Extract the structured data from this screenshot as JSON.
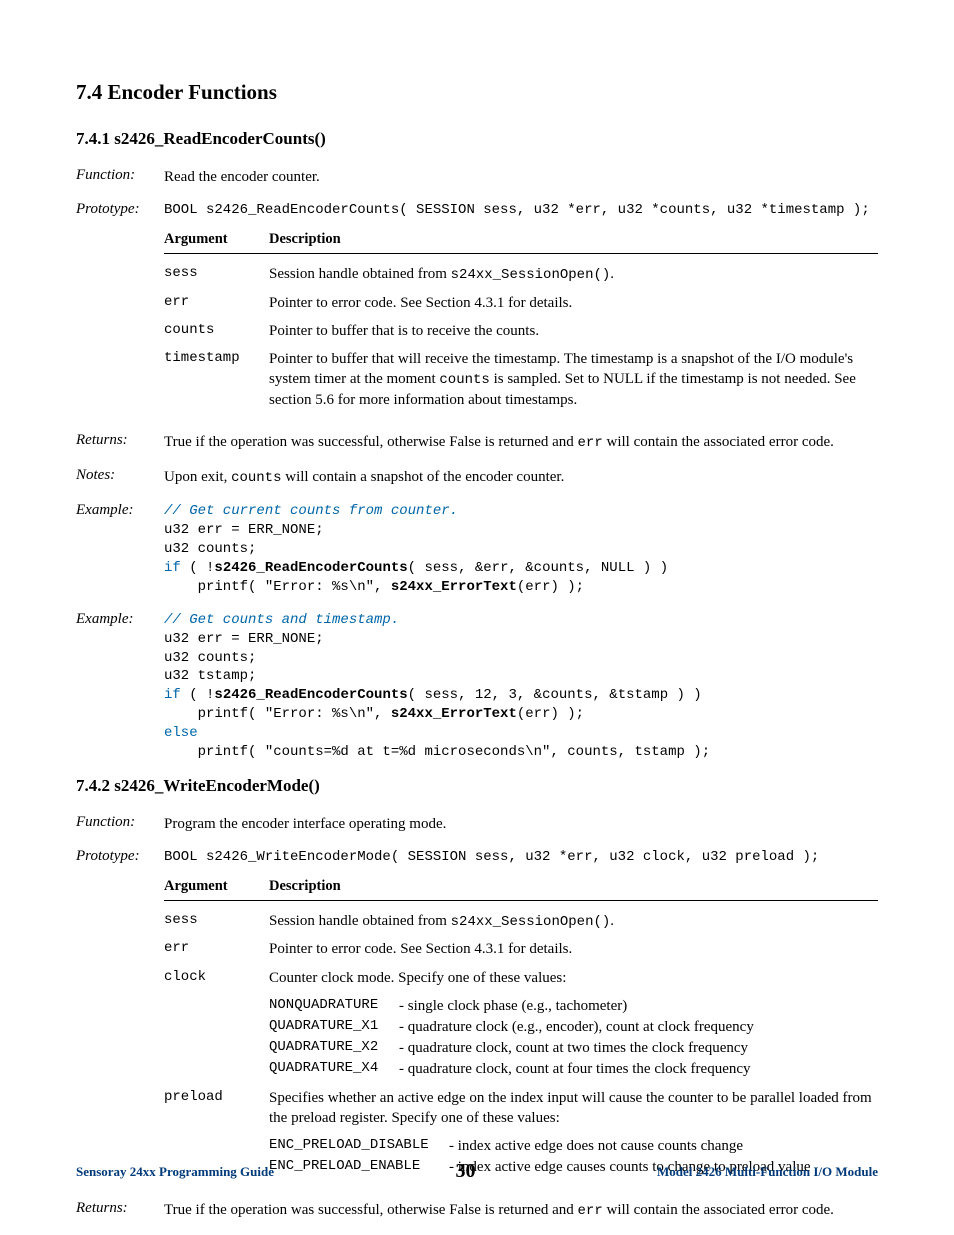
{
  "heading7_4": "7.4  Encoder Functions",
  "sec1": {
    "heading": "7.4.1  s2426_ReadEncoderCounts()",
    "function_label": "Function:",
    "function_text": "Read the encoder counter.",
    "prototype_label": "Prototype:",
    "prototype_code": "BOOL s2426_ReadEncoderCounts( SESSION sess, u32 *err, u32 *counts, u32 *timestamp );",
    "arg_head1": "Argument",
    "arg_head2": "Description",
    "args": {
      "sess_name": "sess",
      "sess_desc_a": "Session handle obtained from ",
      "sess_desc_b": "s24xx_SessionOpen()",
      "sess_desc_c": ".",
      "err_name": "err",
      "err_desc": "Pointer to error code. See Section 4.3.1 for details.",
      "counts_name": "counts",
      "counts_desc": "Pointer to buffer that is to receive the counts.",
      "ts_name": "timestamp",
      "ts_desc_a": "Pointer to buffer that will receive the timestamp. The timestamp is a snapshot of the I/O module's system timer at the moment ",
      "ts_desc_b": "counts",
      "ts_desc_c": " is sampled. Set to NULL if the timestamp is not needed. See section 5.6 for more information about timestamps."
    },
    "returns_label": "Returns:",
    "returns_a": "True if the operation was successful, otherwise False is returned and ",
    "returns_b": "err",
    "returns_c": " will contain the associated error code.",
    "notes_label": "Notes:",
    "notes_a": "Upon exit, ",
    "notes_b": "counts",
    "notes_c": " will contain a snapshot of the encoder counter.",
    "example_label": "Example:",
    "ex1": {
      "l1": "// Get current counts from counter.",
      "l2": "u32 err = ERR_NONE;",
      "l3": "u32 counts;",
      "l4a": "if",
      "l4b": " ( !",
      "l4c": "s2426_ReadEncoderCounts",
      "l4d": "( sess, &err, &counts, NULL ) )",
      "l5a": "    printf( \"Error: %s\\n\", ",
      "l5b": "s24xx_ErrorText",
      "l5c": "(err) );"
    },
    "ex2": {
      "l1": "// Get counts and timestamp.",
      "l2": "u32 err = ERR_NONE;",
      "l3": "u32 counts;",
      "l4": "u32 tstamp;",
      "l5a": "if",
      "l5b": " ( !",
      "l5c": "s2426_ReadEncoderCounts",
      "l5d": "( sess, 12, 3, &counts, &tstamp ) )",
      "l6a": "    printf( \"Error: %s\\n\", ",
      "l6b": "s24xx_ErrorText",
      "l6c": "(err) );",
      "l7": "else",
      "l8": "    printf( \"counts=%d at t=%d microseconds\\n\", counts, tstamp );"
    }
  },
  "sec2": {
    "heading": "7.4.2  s2426_WriteEncoderMode()",
    "function_label": "Function:",
    "function_text": "Program the encoder interface operating mode.",
    "prototype_label": "Prototype:",
    "prototype_code": "BOOL s2426_WriteEncoderMode( SESSION sess, u32 *err, u32 clock, u32 preload );",
    "arg_head1": "Argument",
    "arg_head2": "Description",
    "args": {
      "sess_name": "sess",
      "sess_desc_a": "Session handle obtained from ",
      "sess_desc_b": "s24xx_SessionOpen()",
      "sess_desc_c": ".",
      "err_name": "err",
      "err_desc": "Pointer to error code. See Section 4.3.1 for details.",
      "clock_name": "clock",
      "clock_desc": "Counter clock mode. Specify one of these values:",
      "clock_opts": {
        "o1k": "NONQUADRATURE",
        "o1v": "- single clock phase (e.g., tachometer)",
        "o2k": "QUADRATURE_X1",
        "o2v": "- quadrature clock (e.g., encoder), count at clock frequency",
        "o3k": "QUADRATURE_X2",
        "o3v": "- quadrature clock, count at two times the clock frequency",
        "o4k": "QUADRATURE_X4",
        "o4v": "- quadrature clock, count at four times the clock frequency"
      },
      "preload_name": "preload",
      "preload_desc": "Specifies whether an active edge on the index input will cause the counter to be parallel loaded from the preload register. Specify one of these values:",
      "preload_opts": {
        "o1k": "ENC_PRELOAD_DISABLE",
        "o1v": "- index active edge does not cause counts change",
        "o2k": "ENC_PRELOAD_ENABLE",
        "o2v": "- index active edge causes counts to change to preload value"
      }
    },
    "returns_label": "Returns:",
    "returns_a": "True if the operation was successful, otherwise False is returned and ",
    "returns_b": "err",
    "returns_c": " will contain the associated error code."
  },
  "footer": {
    "left": "Sensoray 24xx Programming Guide",
    "page": "30",
    "right": "Model 2426 Multi-Function I/O Module"
  }
}
